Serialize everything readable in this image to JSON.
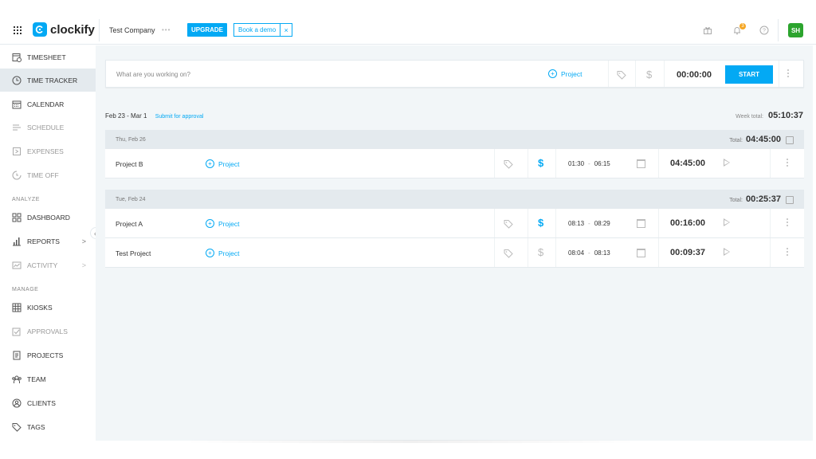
{
  "topbar": {
    "logo_text": "clockify",
    "company": "Test Company",
    "upgrade_label": "UPGRADE",
    "demo_label": "Book a demo",
    "demo_close": "×",
    "avatar_initials": "SH",
    "notification_count": "3",
    "icons": [
      "apps-grid-icon",
      "clock-logo-icon",
      "gift-icon",
      "bell-icon",
      "help-icon"
    ]
  },
  "sidebar": {
    "items": [
      {
        "label": "TIMESHEET",
        "icon": "timesheet-icon"
      },
      {
        "label": "TIME TRACKER",
        "icon": "clock-icon"
      },
      {
        "label": "CALENDAR",
        "icon": "calendar-icon"
      },
      {
        "label": "SCHEDULE",
        "icon": "schedule-icon"
      },
      {
        "label": "EXPENSES",
        "icon": "expenses-icon"
      },
      {
        "label": "TIME OFF",
        "icon": "time-off-icon"
      }
    ],
    "analyze_header": "ANALYZE",
    "analyze_items": [
      {
        "label": "DASHBOARD",
        "icon": "dashboard-icon"
      },
      {
        "label": "REPORTS",
        "icon": "reports-icon",
        "chevron": ">"
      },
      {
        "label": "ACTIVITY",
        "icon": "activity-icon",
        "chevron": ">"
      }
    ],
    "manage_header": "MANAGE",
    "manage_items": [
      {
        "label": "KIOSKS",
        "icon": "kiosk-icon"
      },
      {
        "label": "APPROVALS",
        "icon": "approvals-icon"
      },
      {
        "label": "PROJECTS",
        "icon": "projects-icon"
      },
      {
        "label": "TEAM",
        "icon": "team-icon"
      },
      {
        "label": "CLIENTS",
        "icon": "clients-icon"
      },
      {
        "label": "TAGS",
        "icon": "tag-icon"
      }
    ],
    "collapse_glyph": "«"
  },
  "timer": {
    "placeholder": "What are you working on?",
    "project_label": "Project",
    "currency": "$",
    "time": "00:00:00",
    "start_label": "START"
  },
  "week": {
    "range": "Feb 23 - Mar 1",
    "submit": "Submit for approval",
    "total_label": "Week total:",
    "total": "05:10:37"
  },
  "groups": [
    {
      "date": "Thu, Feb 26",
      "total_label": "Total:",
      "total": "04:45:00",
      "entries": [
        {
          "description": "Project B",
          "project": "Project",
          "billable": true,
          "start": "01:30",
          "end": "06:15",
          "duration": "04:45:00"
        }
      ]
    },
    {
      "date": "Tue, Feb 24",
      "total_label": "Total:",
      "total": "00:25:37",
      "entries": [
        {
          "description": "Project A",
          "project": "Project",
          "billable": true,
          "start": "08:13",
          "end": "08:29",
          "duration": "00:16:00"
        },
        {
          "description": "Test Project",
          "project": "Project",
          "billable": false,
          "start": "08:04",
          "end": "08:13",
          "duration": "00:09:37"
        }
      ]
    }
  ],
  "colors": {
    "accent": "#03a9f4",
    "avatar": "#2ca42e",
    "badge": "#f5a623",
    "background": "#f2f6f8"
  }
}
